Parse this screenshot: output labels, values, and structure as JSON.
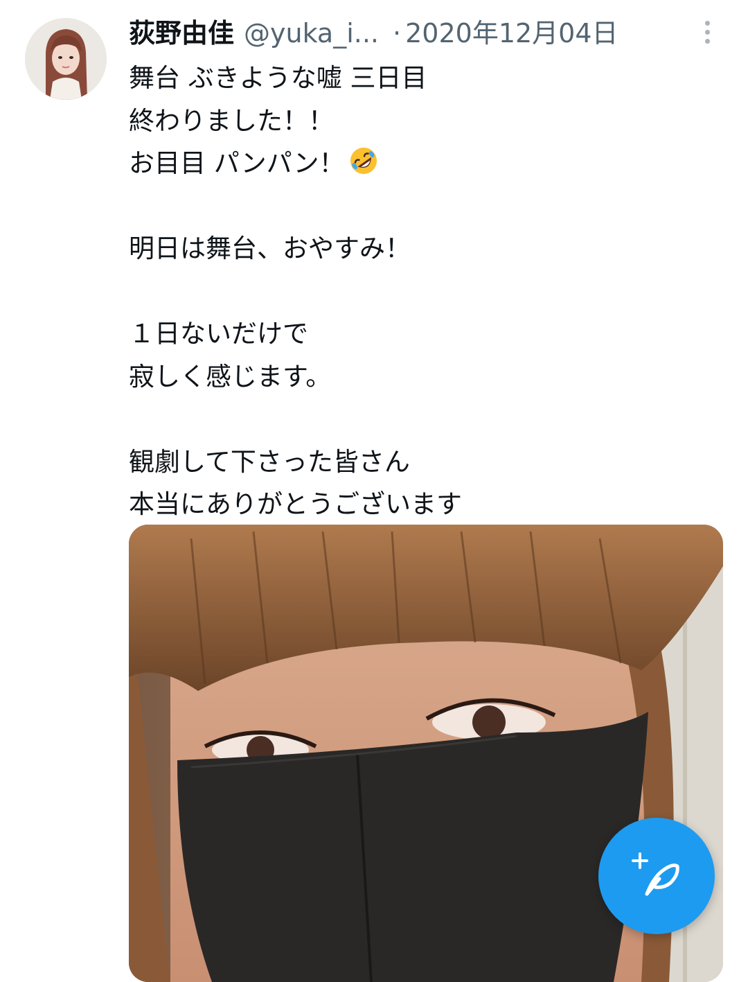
{
  "tweet": {
    "display_name": "荻野由佳",
    "handle": "@yuka_i...",
    "separator": "·",
    "date": "2020年12月04日",
    "text_lines": [
      "舞台 ぶきような嘘 三日目",
      "終わりました！！",
      "お目目 パンパン！",
      "",
      "明日は舞台、おやすみ！",
      "",
      "１日ないだけで",
      "寂しく感じます。",
      "",
      "観劇して下さった皆さん",
      "本当にありがとうございます"
    ],
    "emoji_icon": "rolling-on-floor-laughing-emoji"
  },
  "icons": {
    "more": "more-vertical-icon",
    "compose": "compose-tweet-icon"
  },
  "colors": {
    "accent": "#1d9bf0",
    "secondary_text": "#536471",
    "primary_text": "#0f1419"
  }
}
